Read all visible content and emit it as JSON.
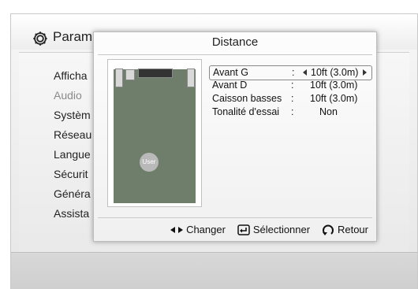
{
  "settings": {
    "title": "Param",
    "menu": [
      {
        "label": "Afficha",
        "dim": false
      },
      {
        "label": "Audio",
        "dim": true
      },
      {
        "label": "Systèm",
        "dim": false
      },
      {
        "label": "Réseau",
        "dim": false
      },
      {
        "label": "Langue",
        "dim": false
      },
      {
        "label": "Sécurit",
        "dim": false
      },
      {
        "label": "Généra",
        "dim": false
      },
      {
        "label": "Assista",
        "dim": false
      }
    ]
  },
  "dialog": {
    "title": "Distance",
    "diagram_user_label": "User",
    "rows": [
      {
        "label": "Avant G",
        "colon": ":",
        "value": "10ft (3.0m)",
        "selected": true
      },
      {
        "label": "Avant D",
        "colon": ":",
        "value": "10ft (3.0m)",
        "selected": false
      },
      {
        "label": "Caisson basses",
        "colon": ":",
        "value": "10ft (3.0m)",
        "selected": false
      },
      {
        "label": "Tonalité d'essai",
        "colon": ":",
        "value": "Non",
        "selected": false
      }
    ],
    "footer": {
      "change": "Changer",
      "select": "Sélectionner",
      "back": "Retour"
    }
  },
  "icons": {
    "header": "gear-icon",
    "left_arrow": "left-arrow-icon",
    "right_arrow": "right-arrow-icon",
    "change": "left-right-arrows-icon",
    "select": "enter-icon",
    "back": "return-icon"
  }
}
